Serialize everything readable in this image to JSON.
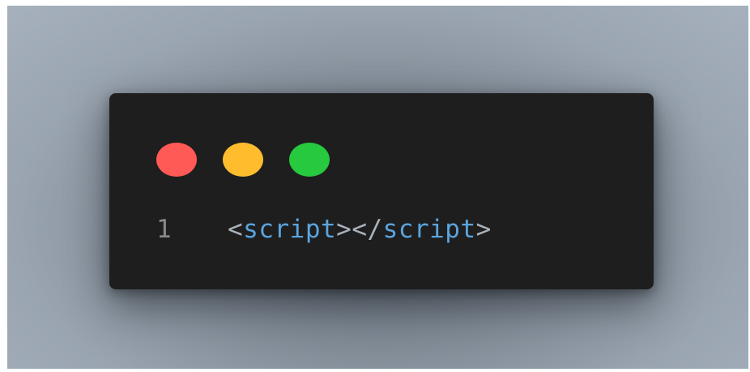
{
  "window": {
    "traffic_lights": [
      {
        "name": "close",
        "color": "#ff5a55"
      },
      {
        "name": "minimize",
        "color": "#ffbd2e"
      },
      {
        "name": "maximize",
        "color": "#27c93f"
      }
    ]
  },
  "code": {
    "line_number": "1",
    "tokens": {
      "open_bracket": "<",
      "open_tag": "script",
      "open_close_bracket": "></",
      "close_tag": "script",
      "close_bracket": ">"
    }
  },
  "colors": {
    "background": "#9aa5b1",
    "editor": "#1e1e1e",
    "tag": "#5aa4dd",
    "punctuation": "#a9b2bb",
    "line_number": "#8a8a8a"
  }
}
